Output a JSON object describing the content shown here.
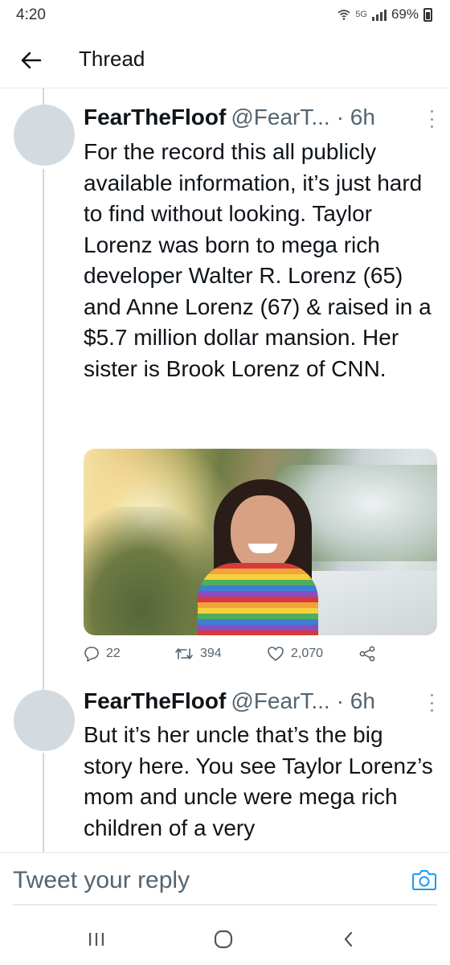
{
  "status_bar": {
    "time": "4:20",
    "network": "5G",
    "battery": "69%"
  },
  "header": {
    "title": "Thread"
  },
  "tweets": [
    {
      "display_name": "FearTheFloof",
      "handle": "@FearT...",
      "time": "· 6h",
      "text": "For the record this all publicly available information, it’s just hard to find without looking. Taylor Lorenz was born to mega rich developer Walter R. Lorenz (65) and Anne Lorenz (67) & raised in a $5.7 million dollar mansion. Her sister is Brook Lorenz of CNN.",
      "stats": {
        "replies": "22",
        "retweets": "394",
        "likes": "2,070"
      }
    },
    {
      "display_name": "FearTheFloof",
      "handle": "@FearT...",
      "time": "· 6h",
      "text": "But it’s her uncle that’s the big story here. You see Taylor Lorenz’s mom and uncle were mega rich children of a very"
    }
  ],
  "reply": {
    "placeholder": "Tweet your reply"
  },
  "colors": {
    "text_primary": "#0f1419",
    "text_secondary": "#536471",
    "accent": "#1d9bf0",
    "avatar_placeholder": "#d3dbe0",
    "divider": "#e6ecf0"
  }
}
